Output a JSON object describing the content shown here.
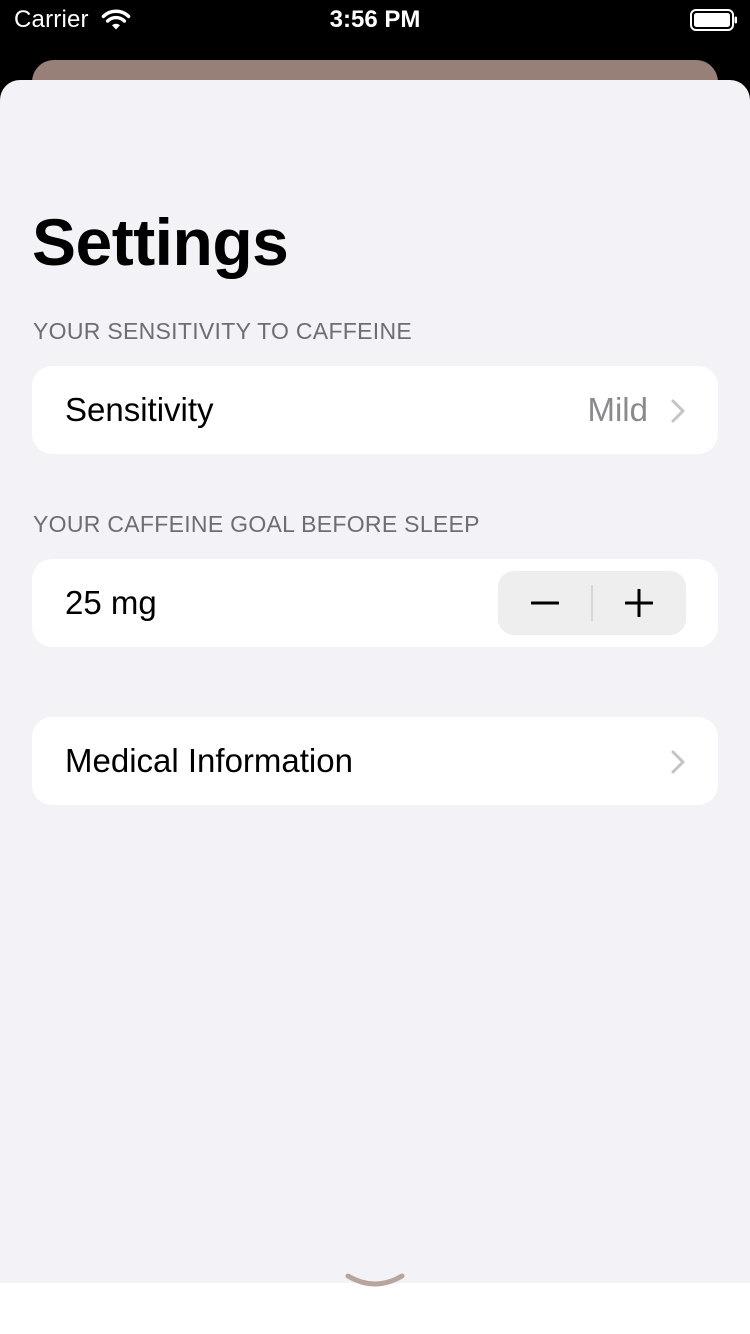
{
  "status_bar": {
    "carrier": "Carrier",
    "time": "3:56 PM",
    "icons": [
      "wifi-icon",
      "battery-icon"
    ]
  },
  "page": {
    "title": "Settings"
  },
  "sensitivity_section": {
    "header": "YOUR SENSITIVITY TO CAFFEINE",
    "row_label": "Sensitivity",
    "row_value": "Mild"
  },
  "goal_section": {
    "header": "YOUR CAFFEINE GOAL BEFORE SLEEP",
    "value": "25 mg",
    "stepper_icons": [
      "minus-icon",
      "plus-icon"
    ]
  },
  "medical_section": {
    "row_label": "Medical Information"
  },
  "colors": {
    "sheet_background": "#f2f2f7",
    "card_background": "#ffffff",
    "secondary_text": "#6d6d72",
    "value_text": "#8a8a8e",
    "back_card": "#968077",
    "dismiss_handle": "#b8a59e"
  }
}
